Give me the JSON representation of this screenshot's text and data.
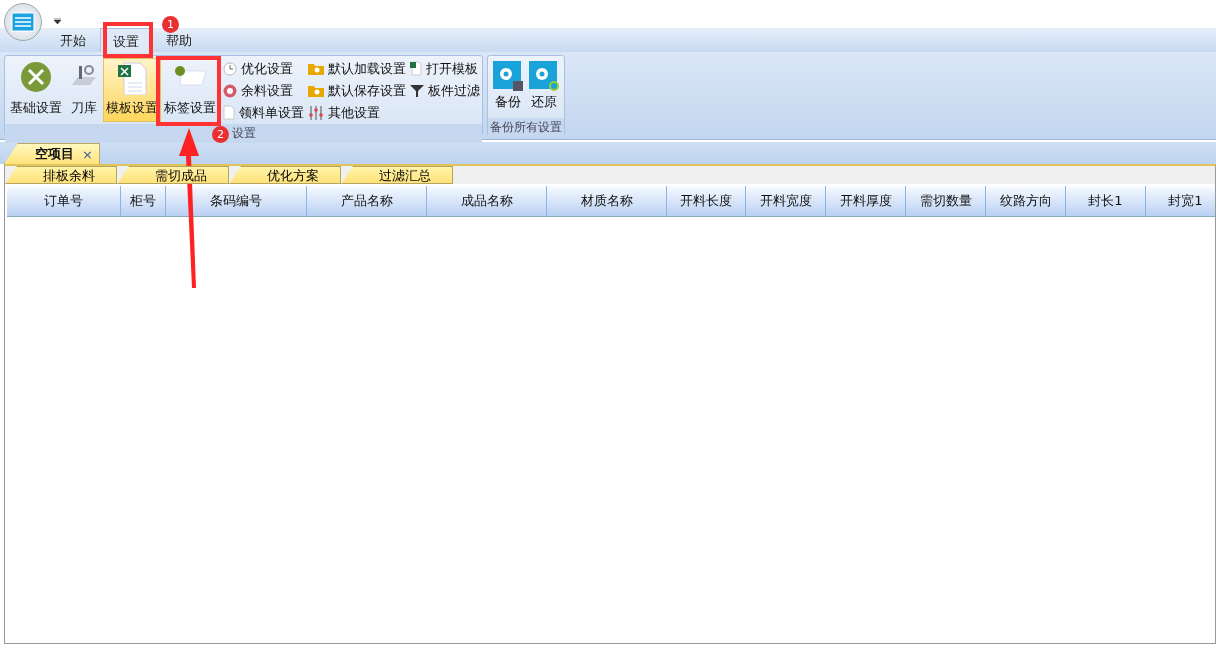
{
  "ribbon_tabs": [
    {
      "label": "开始",
      "selected": false
    },
    {
      "label": "设置",
      "selected": true
    },
    {
      "label": "帮助",
      "selected": false
    }
  ],
  "ribbon_groups": [
    {
      "label": "设置",
      "large_buttons": [
        {
          "label": "基础设置",
          "selected": false
        },
        {
          "label": "刀库",
          "selected": false
        },
        {
          "label": "模板设置",
          "selected": true
        },
        {
          "label": "标签设置",
          "selected": false
        }
      ],
      "small_button_columns": [
        [
          "优化设置",
          "余料设置",
          "领料单设置"
        ],
        [
          "默认加载设置",
          "默认保存设置",
          "其他设置"
        ],
        [
          "打开模板",
          "板件过滤"
        ]
      ]
    },
    {
      "label": "备份所有设置",
      "large_buttons": [
        {
          "label": "备份",
          "selected": false
        },
        {
          "label": "还原",
          "selected": false
        }
      ]
    }
  ],
  "document_tabs": [
    {
      "label": "空项目",
      "close": "×",
      "selected": true
    }
  ],
  "sheet_tabs": [
    "排板余料",
    "需切成品",
    "优化方案",
    "过滤汇总"
  ],
  "table": {
    "columns": [
      "订单号",
      "柜号",
      "条码编号",
      "产品名称",
      "成品名称",
      "材质名称",
      "开料长度",
      "开料宽度",
      "开料厚度",
      "需切数量",
      "纹路方向",
      "封长1",
      "封宽1"
    ]
  },
  "annotations": {
    "badges": [
      "1",
      "2"
    ]
  }
}
